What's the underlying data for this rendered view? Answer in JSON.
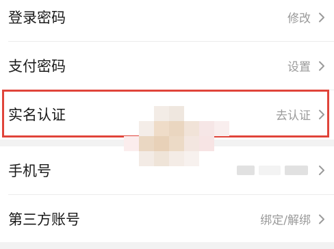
{
  "settings": {
    "rows": [
      {
        "label": "登录密码",
        "value": "修改"
      },
      {
        "label": "支付密码",
        "value": "设置"
      },
      {
        "label": "实名认证",
        "value": "去认证"
      },
      {
        "label": "手机号",
        "value": ""
      },
      {
        "label": "第三方账号",
        "value": "绑定/解绑"
      }
    ]
  },
  "colors": {
    "background": "#f2f2f2",
    "row_bg": "#ffffff",
    "label": "#1a1a1a",
    "value": "#9a9a9a",
    "highlight": "#e0443a"
  },
  "icons": {
    "chevron": "chevron-right-icon"
  }
}
